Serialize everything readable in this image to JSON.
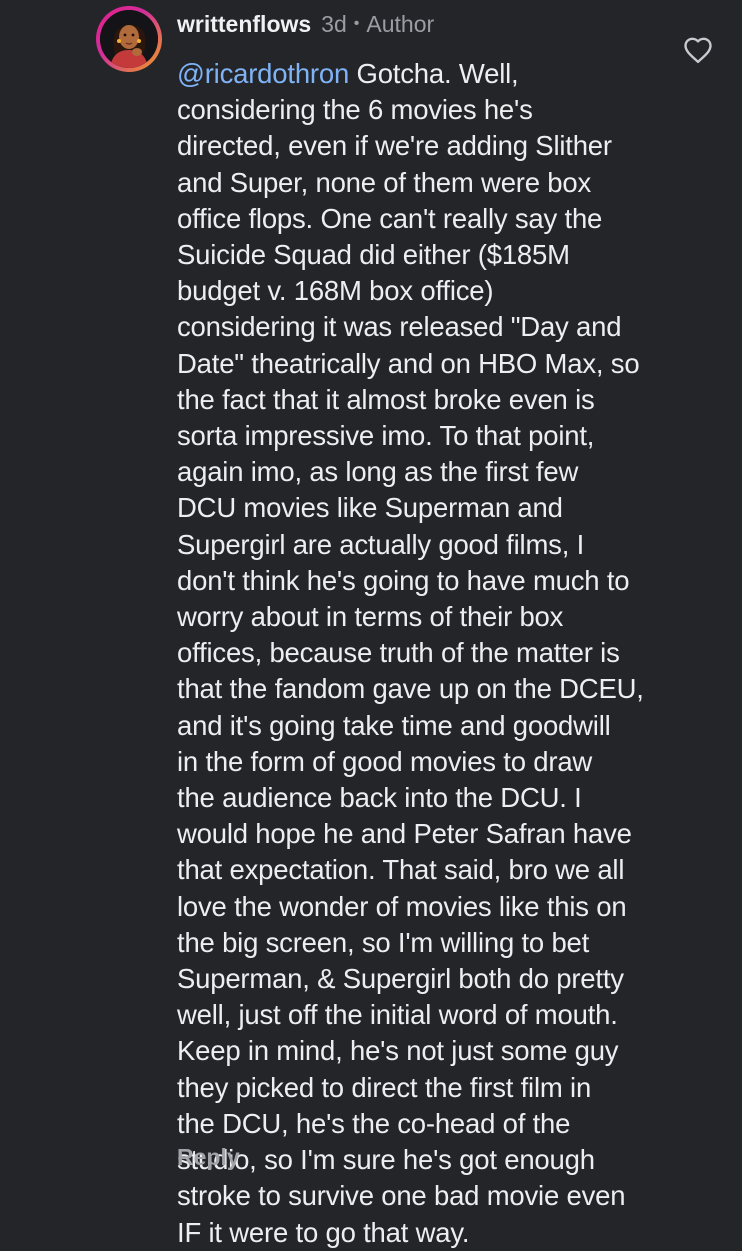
{
  "comment": {
    "username": "writtenflows",
    "time": "3d",
    "separator": "•",
    "author_tag": "Author",
    "mention": "@ricardothron",
    "first_line_rest": " Gotcha. Well,",
    "lines": [
      "considering the 6 movies he's",
      "directed, even if we're adding Slither",
      "and Super, none of them were box",
      "office flops. One can't really say the",
      "Suicide Squad did either ($185M",
      "budget v. 168M box office)",
      "considering it was released \"Day and",
      "Date\" theatrically and on HBO Max, so",
      "the fact that it almost broke even is",
      "sorta impressive imo. To that point,",
      "again imo, as long as the first few",
      "DCU movies like Superman and",
      "Supergirl are actually good films, I",
      "don't think he's going to have much to",
      "worry about in terms of their box",
      "offices, because truth of the matter is",
      "that the fandom gave up on the DCEU,",
      "and it's going take time and goodwill",
      "in the form of good movies to draw",
      "the audience back into the DCU. I",
      "would hope he and Peter Safran have",
      "that expectation. That said, bro we all",
      "love the wonder of movies like this on",
      "the big screen, so I'm willing to bet",
      "Superman, & Supergirl both do pretty",
      "well, just off the initial word of mouth.",
      "Keep in mind, he's not just some guy",
      "they picked to direct the first film in",
      "the DCU, he's the co-head of the",
      "studio, so I'm sure he's got enough",
      "stroke to survive one bad movie even",
      "IF it were to go that way."
    ],
    "reply_label": "Reply",
    "like_icon": "heart-outline-icon"
  },
  "colors": {
    "background": "#232529",
    "mention": "#7fb3f5",
    "muted": "#9b9da3"
  }
}
